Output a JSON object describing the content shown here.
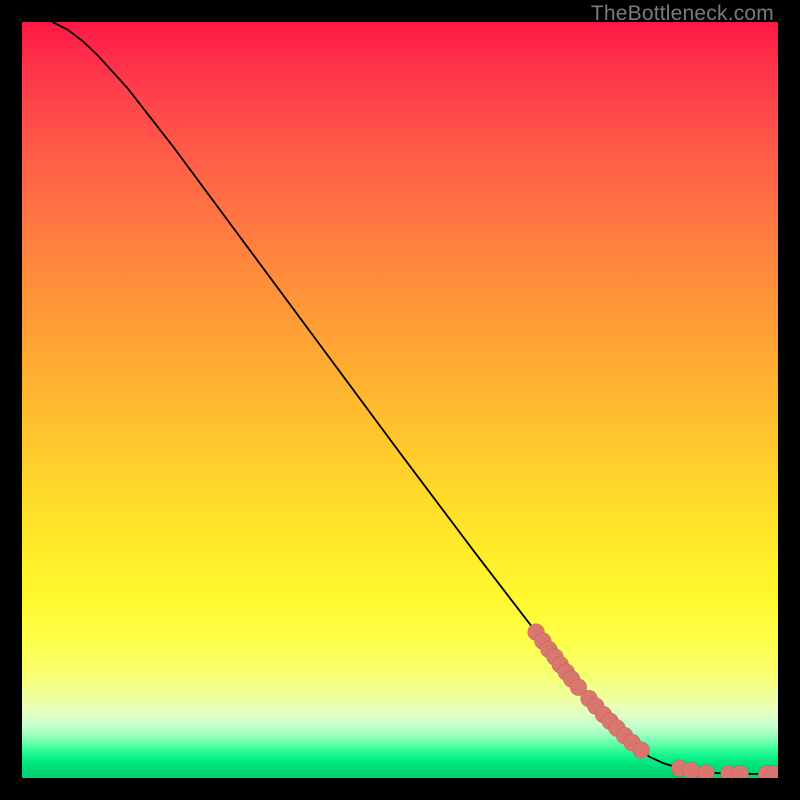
{
  "watermark": "TheBottleneck.com",
  "colors": {
    "page_bg": "#000000",
    "curve": "#000000",
    "point_fill": "#d9766e",
    "gradient_top": "#ff1744",
    "gradient_mid": "#ffe92a",
    "gradient_bottom": "#00cf6d"
  },
  "chart_data": {
    "type": "line",
    "title": "",
    "xlabel": "",
    "ylabel": "",
    "xlim": [
      0,
      100
    ],
    "ylim": [
      0,
      100
    ],
    "grid": false,
    "legend": false,
    "series": [
      {
        "name": "curve",
        "x": [
          4,
          6,
          8,
          10,
          14,
          20,
          30,
          40,
          50,
          60,
          70,
          75,
          80,
          83,
          85,
          87,
          89,
          91,
          93,
          95,
          97,
          99.5
        ],
        "y": [
          100,
          99,
          97.5,
          95.6,
          91.2,
          83.5,
          70,
          56.5,
          43,
          29.7,
          16.7,
          10.5,
          5.2,
          2.8,
          1.9,
          1.3,
          0.9,
          0.7,
          0.6,
          0.55,
          0.55,
          0.55
        ]
      }
    ],
    "scatter_points": [
      {
        "x": 68.0,
        "y": 19.3
      },
      {
        "x": 68.9,
        "y": 18.1
      },
      {
        "x": 69.7,
        "y": 17.0
      },
      {
        "x": 70.5,
        "y": 16.0
      },
      {
        "x": 71.2,
        "y": 15.0
      },
      {
        "x": 72.0,
        "y": 14.0
      },
      {
        "x": 72.7,
        "y": 13.1
      },
      {
        "x": 73.6,
        "y": 12.0
      },
      {
        "x": 75.0,
        "y": 10.5
      },
      {
        "x": 75.9,
        "y": 9.5
      },
      {
        "x": 76.9,
        "y": 8.4
      },
      {
        "x": 77.8,
        "y": 7.5
      },
      {
        "x": 78.7,
        "y": 6.6
      },
      {
        "x": 79.7,
        "y": 5.6
      },
      {
        "x": 80.7,
        "y": 4.7
      },
      {
        "x": 81.9,
        "y": 3.7
      },
      {
        "x": 87.0,
        "y": 1.3
      },
      {
        "x": 88.5,
        "y": 1.0
      },
      {
        "x": 90.5,
        "y": 0.7
      },
      {
        "x": 93.5,
        "y": 0.6
      },
      {
        "x": 95.0,
        "y": 0.55
      },
      {
        "x": 98.5,
        "y": 0.55
      },
      {
        "x": 99.5,
        "y": 0.55
      }
    ]
  }
}
